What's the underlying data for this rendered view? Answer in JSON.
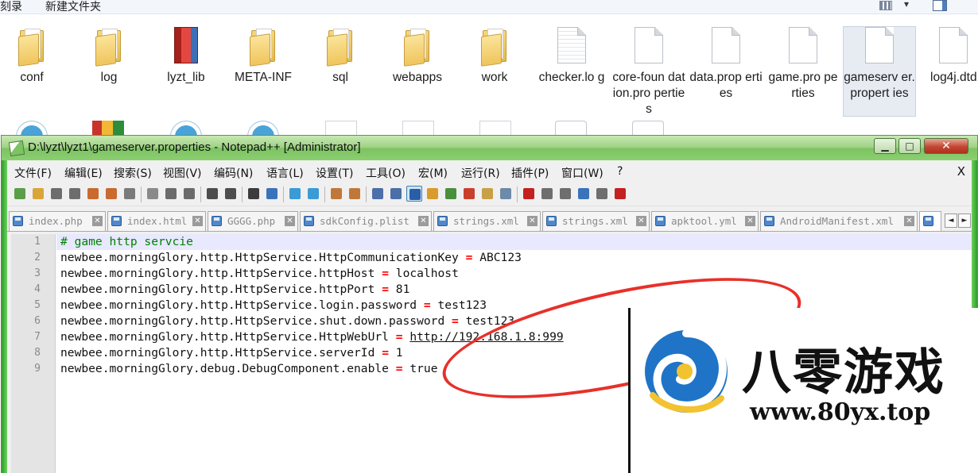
{
  "explorer": {
    "toolbar": {
      "left_item": "刻录",
      "new_folder": "新建文件夹"
    },
    "files": [
      {
        "name": "conf",
        "type": "folder"
      },
      {
        "name": "log",
        "type": "folder"
      },
      {
        "name": "lyzt_lib",
        "type": "library"
      },
      {
        "name": "META-INF",
        "type": "folder"
      },
      {
        "name": "sql",
        "type": "folder"
      },
      {
        "name": "webapps",
        "type": "folder"
      },
      {
        "name": "work",
        "type": "folder"
      },
      {
        "name": "checker.lo g",
        "type": "log-file"
      },
      {
        "name": "core-foun dation.pro perties",
        "type": "file"
      },
      {
        "name": "data.prop erties",
        "type": "file"
      },
      {
        "name": "game.pro perties",
        "type": "file"
      },
      {
        "name": "gameserv er.propert ies",
        "type": "file",
        "selected": true
      },
      {
        "name": "log4j.dtd",
        "type": "file"
      }
    ]
  },
  "npp": {
    "title": "D:\\lyzt\\lyzt1\\gameserver.properties - Notepad++ [Administrator]",
    "window_buttons": {
      "minimize": "▁",
      "maximize": "□",
      "close": "✕"
    },
    "menu": [
      "文件(F)",
      "编辑(E)",
      "搜索(S)",
      "视图(V)",
      "编码(N)",
      "语言(L)",
      "设置(T)",
      "工具(O)",
      "宏(M)",
      "运行(R)",
      "插件(P)",
      "窗口(W)",
      "?"
    ],
    "menu_close": "X",
    "toolbar_icons": [
      "new-file-icon",
      "open-file-icon",
      "save-icon",
      "save-all-icon",
      "close-icon",
      "close-all-icon",
      "print-icon",
      "cut-icon",
      "copy-icon",
      "paste-icon",
      "undo-icon",
      "redo-icon",
      "find-icon",
      "replace-icon",
      "zoom-in-icon",
      "zoom-out-icon",
      "sync-vertical-icon",
      "sync-horizontal-icon",
      "word-wrap-icon",
      "show-all-chars-icon",
      "indent-guide-icon",
      "udl-icon",
      "doc-map-icon",
      "function-list-icon",
      "folder-as-workspace-icon",
      "monitoring-icon",
      "record-macro-icon",
      "stop-record-icon",
      "play-macro-icon",
      "run-macro-multiple-icon",
      "save-macro-icon",
      "spell-check-icon"
    ],
    "tabs": [
      "index.php",
      "index.html",
      "GGGG.php",
      "sdkConfig.plist",
      "strings.xml",
      "strings.xml",
      "apktool.yml",
      "AndroidManifest.xml",
      ""
    ],
    "tab_scroll": {
      "left": "◄",
      "right": "►"
    },
    "lines": [
      {
        "no": "1",
        "comment": "# game http servcie"
      },
      {
        "no": "2",
        "key": "newbee.morningGlory.http.HttpService.HttpCommunicationKey",
        "op": "=",
        "value": "ABC123"
      },
      {
        "no": "3",
        "key": "newbee.morningGlory.http.HttpService.httpHost",
        "op": "=",
        "value": "localhost"
      },
      {
        "no": "4",
        "key": "newbee.morningGlory.http.HttpService.httpPort",
        "op": "=",
        "value": "81"
      },
      {
        "no": "5",
        "key": "newbee.morningGlory.http.HttpService.login.password",
        "op": "=",
        "value": "test123"
      },
      {
        "no": "6",
        "key": "newbee.morningGlory.http.HttpService.shut.down.password",
        "op": "=",
        "value": "test123"
      },
      {
        "no": "7",
        "key": "newbee.morningGlory.http.HttpService.HttpWebUrl",
        "op": "=",
        "value": "http://192.168.1.8:999"
      },
      {
        "no": "8",
        "key": "newbee.morningGlory.http.HttpService.serverId",
        "op": "=",
        "value": "1"
      },
      {
        "no": "9",
        "key": "newbee.morningGlory.debug.DebugComponent.enable",
        "op": "=",
        "value": "true"
      }
    ]
  },
  "watermark": {
    "title": "八零游戏",
    "url": "www.80yx.top"
  },
  "colors": {
    "titlebar": "#9ed184",
    "comment": "#008000",
    "operator": "#ff0000",
    "annotation": "#e8302a"
  }
}
